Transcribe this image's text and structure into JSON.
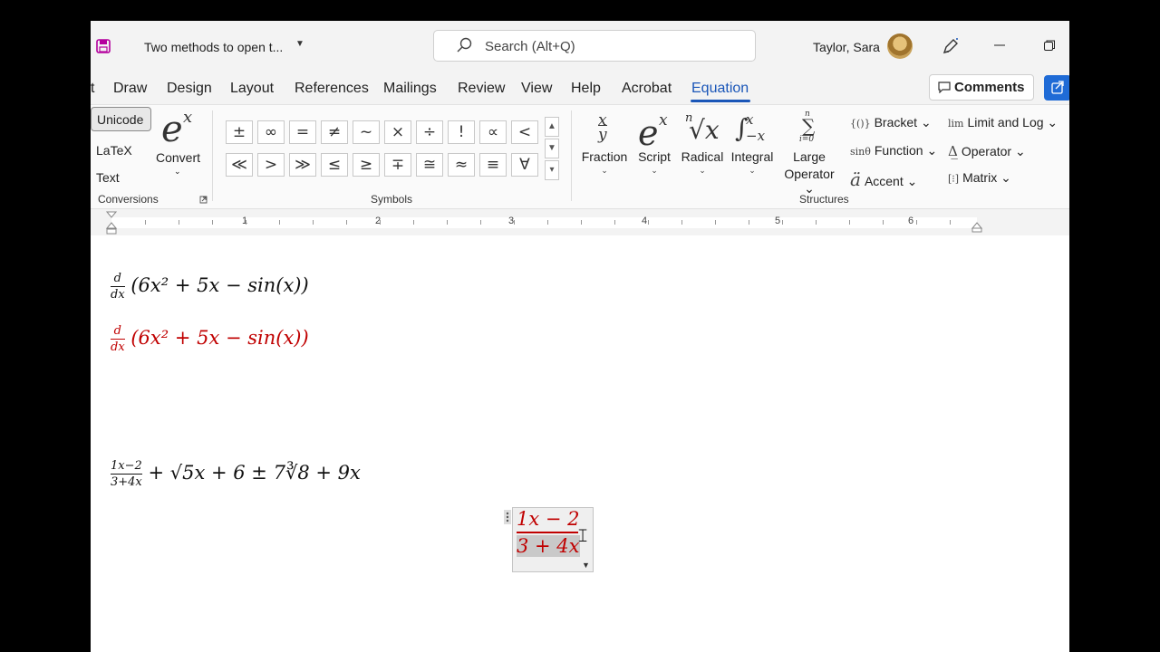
{
  "window": {
    "doc_title": "Two methods to open t...",
    "search_placeholder": "Search (Alt+Q)",
    "user_name": "Taylor, Sara"
  },
  "tabs": [
    "t",
    "Draw",
    "Design",
    "Layout",
    "References",
    "Mailings",
    "Review",
    "View",
    "Help",
    "Acrobat",
    "Equation"
  ],
  "active_tab": "Equation",
  "comments_label": "Comments",
  "ribbon": {
    "conversions": {
      "unicode": "Unicode",
      "latex": "LaTeX",
      "text": "Text",
      "convert_glyph": "e",
      "convert_sup": "x",
      "convert_label": "Convert",
      "group_label": "Conversions"
    },
    "symbols": {
      "row1": [
        "±",
        "∞",
        "=",
        "≠",
        "~",
        "×",
        "÷",
        "!",
        "∝",
        "<"
      ],
      "row2": [
        "≪",
        ">",
        "≫",
        "≤",
        "≥",
        "∓",
        "≅",
        "≈",
        "≡",
        "∀"
      ],
      "group_label": "Symbols"
    },
    "structures": {
      "fraction": "Fraction",
      "script": "Script",
      "radical": "Radical",
      "integral": "Integral",
      "large_operator_1": "Large",
      "large_operator_2": "Operator",
      "bracket": "Bracket",
      "function": "Function",
      "accent": "Accent",
      "limit_log": "Limit and Log",
      "operator": "Operator",
      "matrix": "Matrix",
      "group_label": "Structures"
    }
  },
  "ruler": [
    "1",
    "2",
    "3",
    "4",
    "5",
    "6"
  ],
  "document": {
    "eq1_frac_num": "d",
    "eq1_frac_den": "dx",
    "eq1_body": "(6x² + 5x − sin(x))",
    "eq2_frac_num": "d",
    "eq2_frac_den": "dx",
    "eq2_body": "(6x² + 5x − sin(x))",
    "eq3_frac_num": "1x−2",
    "eq3_frac_den": "3+4x",
    "eq3_body": "+ √5x + 6 ± 7∛8 + 9x",
    "edit_num": "1x − 2",
    "edit_den": "3 + 4x"
  },
  "colors": {
    "accent": "#1a56b8",
    "equation_red": "#c00000",
    "brand_word": "#b4009e"
  }
}
